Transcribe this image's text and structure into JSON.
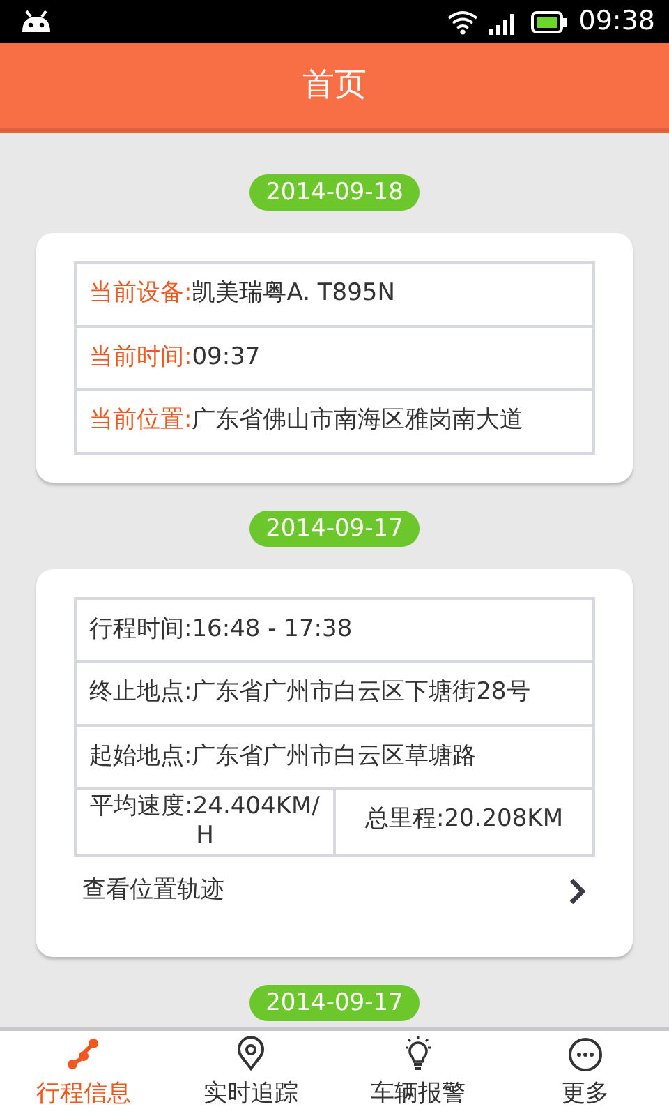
{
  "status_bar": {
    "time": "09:38"
  },
  "header": {
    "title": "首页"
  },
  "sections": [
    {
      "date": "2014-09-18",
      "kind": "accent",
      "rows": [
        [
          {
            "label": "当前设备:",
            "value": "凯美瑞粤A. T895N"
          }
        ],
        [
          {
            "label": "当前时间:",
            "value": "09:37"
          }
        ],
        [
          {
            "label": "当前位置:",
            "value": "广东省佛山市南海区雅岗南大道"
          }
        ]
      ]
    },
    {
      "date": "2014-09-17",
      "kind": "plain",
      "rows": [
        [
          {
            "label": "行程时间:",
            "value": "16:48 - 17:38"
          }
        ],
        [
          {
            "label": "终止地点:",
            "value": "广东省广州市白云区下塘街28号"
          }
        ],
        [
          {
            "label": "起始地点:",
            "value": "广东省广州市白云区草塘路"
          }
        ],
        [
          {
            "label": "平均速度:",
            "value": "24.404KM/H"
          },
          {
            "label": "总里程:",
            "value": "20.208KM"
          }
        ]
      ],
      "link": "查看位置轨迹"
    },
    {
      "date": "2014-09-17"
    }
  ],
  "tabs": [
    {
      "label": "行程信息",
      "kind": "route",
      "selected": true
    },
    {
      "label": "实时追踪",
      "kind": "pin",
      "selected": false
    },
    {
      "label": "车辆报警",
      "kind": "bulb",
      "selected": false
    },
    {
      "label": "更多",
      "kind": "more",
      "selected": false
    }
  ]
}
